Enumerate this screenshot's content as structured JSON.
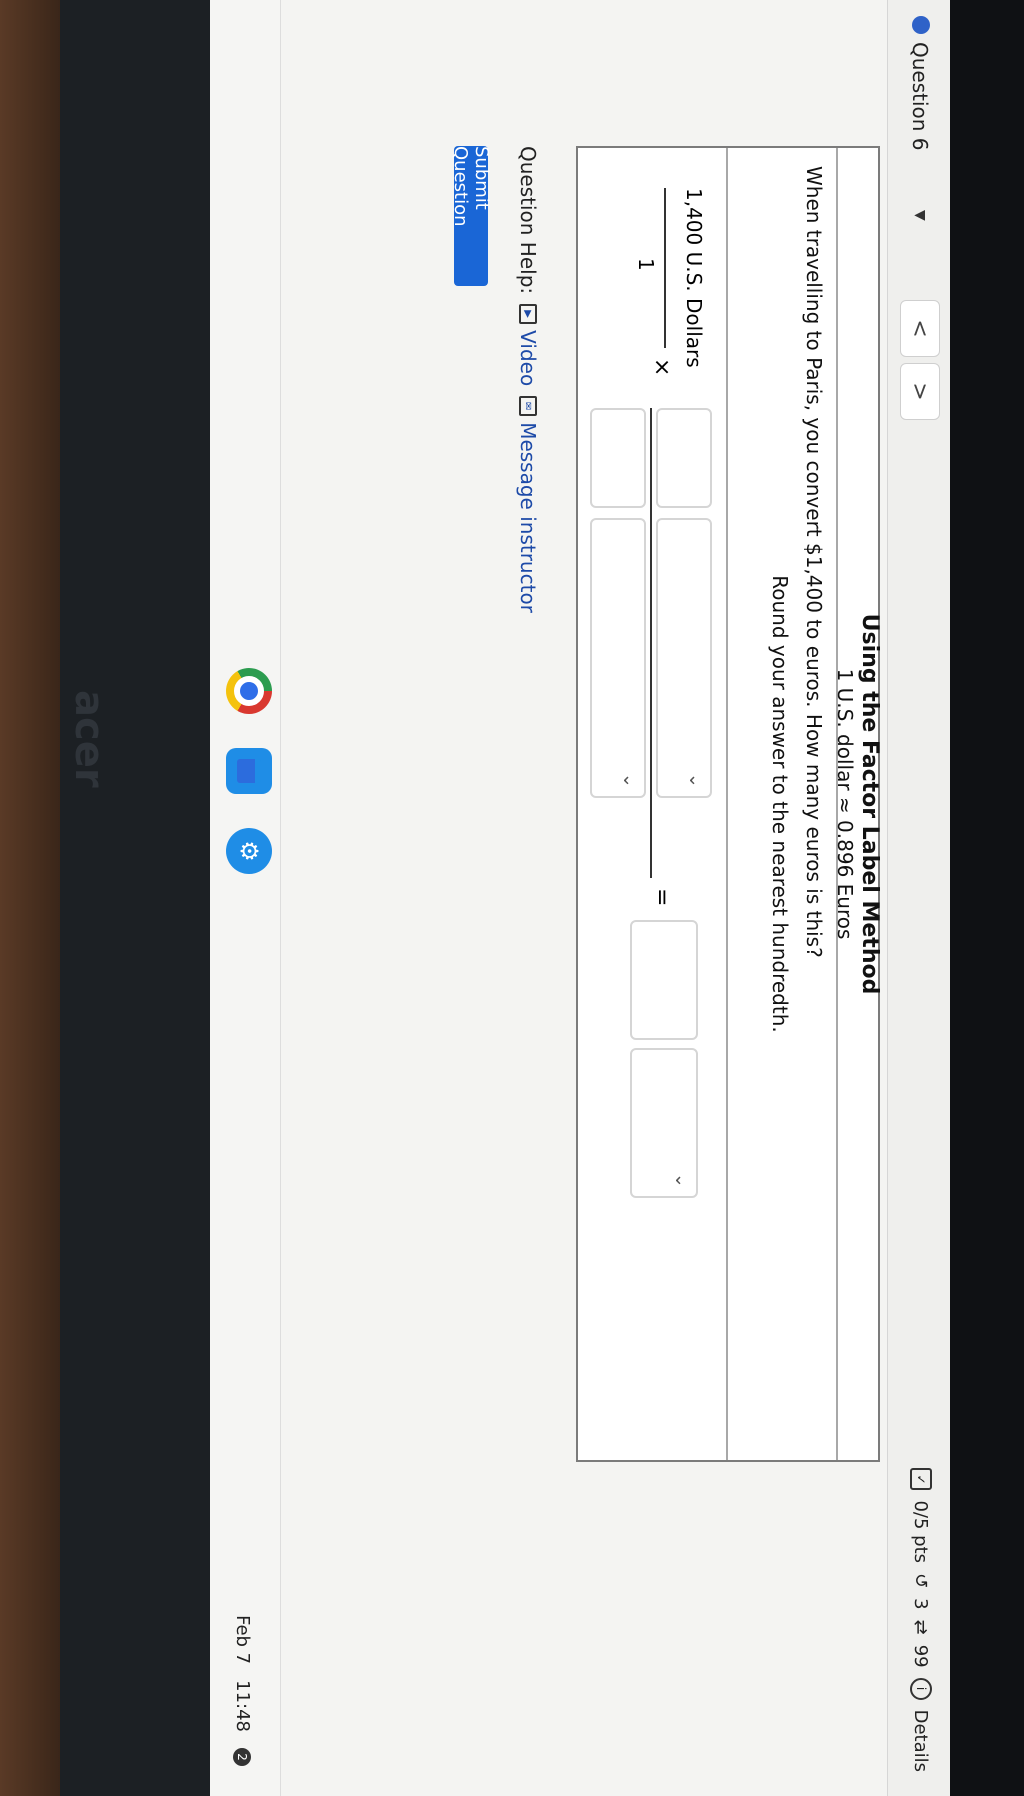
{
  "question": {
    "label": "Question 6",
    "dropdown_symbol": "▼",
    "nav_prev": "<",
    "nav_next": ">",
    "points": "0/5 pts",
    "attempts_icon": "↺",
    "attempts": "3",
    "score_icon": "⇄",
    "score": "99",
    "details_icon": "i",
    "details": "Details"
  },
  "table": {
    "title": "Using the Factor Label Method",
    "subtitle": "1 U.S. dollar ≈ 0.896 Euros",
    "prompt": "When travelling to Paris, you convert $1,400 to euros. How many euros is this?",
    "round": "Round your answer to the nearest hundredth."
  },
  "work": {
    "frac_top": "1,400 U.S. Dollars",
    "frac_bot": "1",
    "times": "×",
    "equals": "="
  },
  "help": {
    "label": "Question Help:",
    "video": "Video",
    "message": "Message instructor"
  },
  "submit": {
    "label": "Submit Question"
  },
  "taskbar": {
    "date": "Feb 7",
    "time": "11:48",
    "badge": "2",
    "brand": "acer"
  }
}
